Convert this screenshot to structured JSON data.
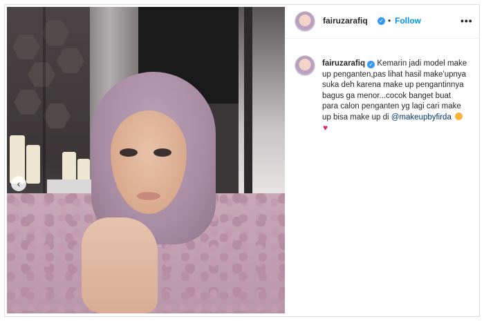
{
  "post": {
    "username": "fairuzarafiq",
    "separator": "•",
    "follow_label": "Follow",
    "more_label": "•••",
    "caption": {
      "username": "fairuzarafiq",
      "text": "Kemarin jadi model make up penganten,pas lihat hasil make'upnya suka deh karena make up pengantinnya bagus ga menor...cocok banget buat para calon penganten yg lagi cari make up bisa make up di",
      "mention": "@makeupbyfirda",
      "emoji_1": "heart-eyes-emoji",
      "emoji_2": "♥"
    },
    "carousel_prev": "‹"
  },
  "colors": {
    "accent": "#0095f6",
    "verified": "#3897f0",
    "mention": "#00376b"
  }
}
